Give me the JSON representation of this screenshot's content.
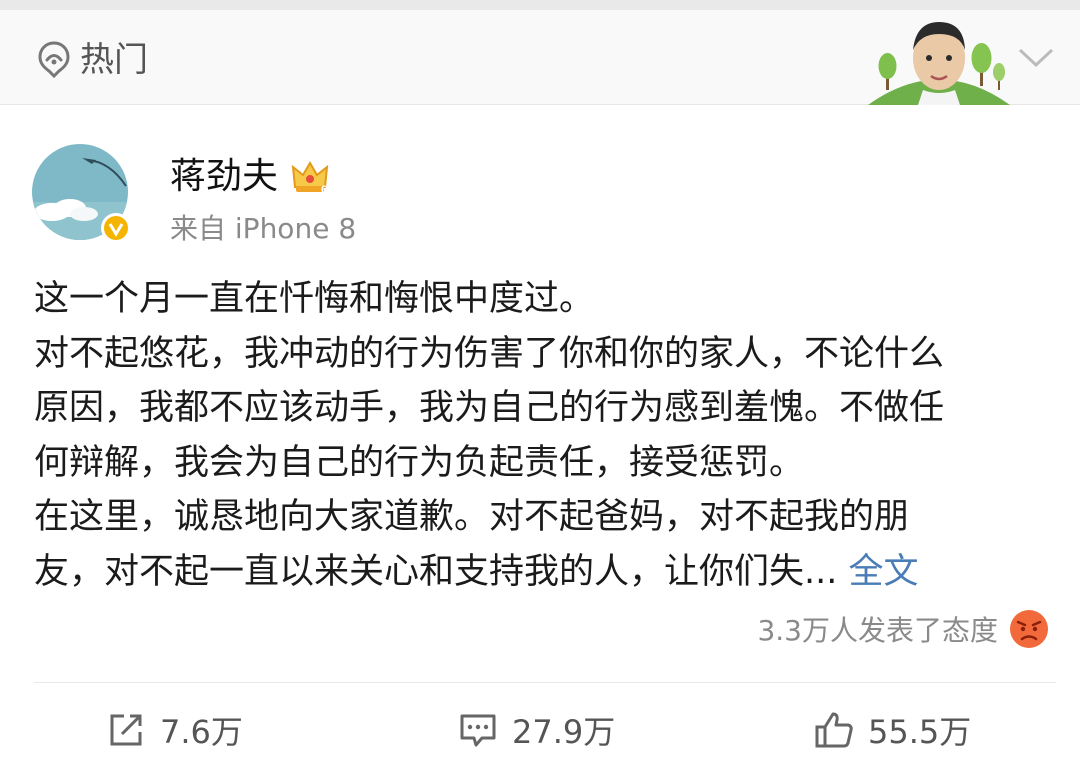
{
  "header": {
    "hot_label": "热门"
  },
  "post": {
    "author": "蒋劲夫",
    "source": "来自 iPhone 8",
    "lines": [
      "这一个月一直在忏悔和悔恨中度过。",
      "对不起悠花，我冲动的行为伤害了你和你的家人，不论什么",
      "原因，我都不应该动手，我为自己的行为感到羞愧。不做任",
      "何辩解，我会为自己的行为负起责任，接受惩罚。",
      "在这里，诚恳地向大家道歉。对不起爸妈，对不起我的朋"
    ],
    "last_line": "友，对不起一直以来关心和支持我的人，让你们失...",
    "full_text_link": "全文",
    "reactions_text": "3.3万人发表了态度"
  },
  "actions": {
    "repost_count": "7.6万",
    "comment_count": "27.9万",
    "like_count": "55.5万"
  },
  "colors": {
    "link": "#4a7cb6",
    "secondary_text": "#8a8a8a",
    "verified_badge": "#f4b400",
    "angry_face": "#f26a3c"
  },
  "icons": {
    "hot": "hot-topic-icon",
    "crown": "vip-crown-icon",
    "verified": "verified-badge-icon",
    "angry": "angry-emoji-icon",
    "repost": "repost-icon",
    "comment": "comment-icon",
    "like": "like-thumb-icon",
    "expand": "chevron-down-icon"
  }
}
